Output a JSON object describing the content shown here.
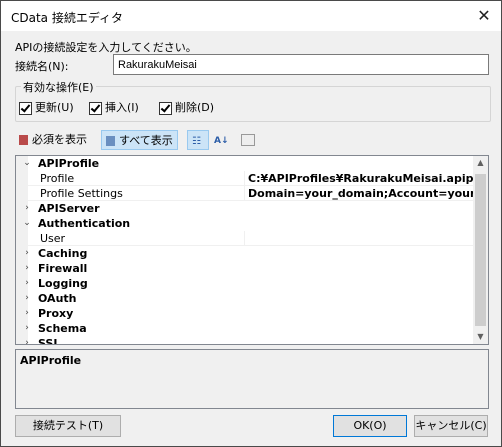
{
  "window": {
    "title": "CData 接続エディタ",
    "close": "✕"
  },
  "instruction": "APIの接続設定を入力してください。",
  "connection_name": {
    "label": "接続名(N):",
    "value": "RakurakuMeisai"
  },
  "operations": {
    "label": "有効な操作(E)",
    "items": [
      {
        "label": "更新(U)",
        "checked": true
      },
      {
        "label": "挿入(I)",
        "checked": true
      },
      {
        "label": "削除(D)",
        "checked": true
      }
    ]
  },
  "toolbar": {
    "required": "必須を表示",
    "show_all": "すべて表示"
  },
  "properties": [
    {
      "type": "category",
      "name": "APIProfile",
      "expanded": true
    },
    {
      "type": "prop",
      "name": "Profile",
      "value": "C:¥APIProfiles¥RakurakuMeisai.apip"
    },
    {
      "type": "prop",
      "name": "Profile Settings",
      "value": "Domain=your_domain;Account=your_ac"
    },
    {
      "type": "category",
      "name": "APIServer",
      "expanded": false
    },
    {
      "type": "category",
      "name": "Authentication",
      "expanded": true
    },
    {
      "type": "prop",
      "name": "User",
      "value": ""
    },
    {
      "type": "category",
      "name": "Caching",
      "expanded": false
    },
    {
      "type": "category",
      "name": "Firewall",
      "expanded": false
    },
    {
      "type": "category",
      "name": "Logging",
      "expanded": false
    },
    {
      "type": "category",
      "name": "OAuth",
      "expanded": false
    },
    {
      "type": "category",
      "name": "Proxy",
      "expanded": false
    },
    {
      "type": "category",
      "name": "Schema",
      "expanded": false
    },
    {
      "type": "category",
      "name": "SSL",
      "expanded": false
    }
  ],
  "description": {
    "title": "APIProfile"
  },
  "buttons": {
    "test": "接続テスト(T)",
    "ok": "OK(O)",
    "cancel": "キャンセル(C)"
  }
}
